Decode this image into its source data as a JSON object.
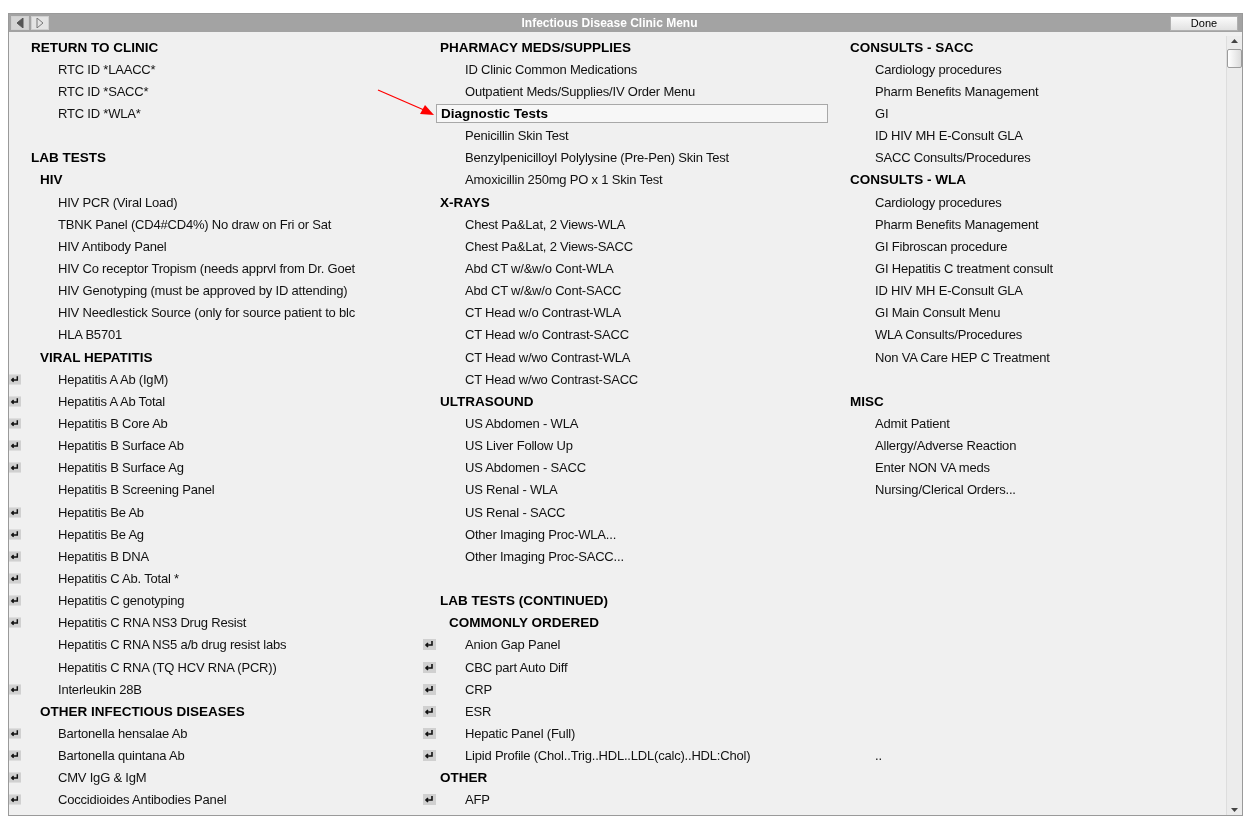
{
  "window": {
    "title": "Infectious Disease Clinic Menu"
  },
  "nav": [
    {
      "kind": "back",
      "disabled": false
    },
    {
      "kind": "forward",
      "disabled": true
    }
  ],
  "done_button": "Done",
  "columns": [
    {
      "rows": [
        {
          "kind": "header",
          "label": "RETURN TO CLINIC",
          "selected": false
        },
        {
          "kind": "item",
          "label": "RTC ID *LAACC*",
          "quick": false,
          "selected": false
        },
        {
          "kind": "item",
          "label": "RTC ID *SACC*",
          "quick": false,
          "selected": false
        },
        {
          "kind": "item",
          "label": "RTC ID *WLA*",
          "quick": false,
          "selected": false
        },
        {
          "kind": "blank"
        },
        {
          "kind": "header",
          "label": "LAB TESTS",
          "selected": false
        },
        {
          "kind": "subheader",
          "label": "HIV",
          "selected": false
        },
        {
          "kind": "item",
          "label": "HIV PCR (Viral Load)",
          "quick": false,
          "selected": false
        },
        {
          "kind": "item",
          "label": "TBNK Panel (CD4#CD4%) No draw on Fri or Sat",
          "quick": false,
          "selected": false
        },
        {
          "kind": "item",
          "label": "HIV Antibody Panel",
          "quick": false,
          "selected": false
        },
        {
          "kind": "item",
          "label": "HIV Co receptor Tropism (needs apprvl from Dr. Goet",
          "quick": false,
          "selected": false
        },
        {
          "kind": "item",
          "label": "HIV Genotyping (must be approved by ID attending)",
          "quick": false,
          "selected": false
        },
        {
          "kind": "item",
          "label": "HIV Needlestick Source (only for source patient to blc",
          "quick": false,
          "selected": false
        },
        {
          "kind": "item",
          "label": "HLA B5701",
          "quick": false,
          "selected": false
        },
        {
          "kind": "subheader",
          "label": "VIRAL HEPATITIS",
          "selected": false
        },
        {
          "kind": "item",
          "label": "Hepatitis A Ab (IgM)",
          "quick": true,
          "selected": false
        },
        {
          "kind": "item",
          "label": "Hepatitis A Ab Total",
          "quick": true,
          "selected": false
        },
        {
          "kind": "item",
          "label": "Hepatitis B Core Ab",
          "quick": true,
          "selected": false
        },
        {
          "kind": "item",
          "label": "Hepatitis B Surface Ab",
          "quick": true,
          "selected": false
        },
        {
          "kind": "item",
          "label": "Hepatitis B Surface Ag",
          "quick": true,
          "selected": false
        },
        {
          "kind": "item",
          "label": "Hepatitis B Screening Panel",
          "quick": false,
          "selected": false
        },
        {
          "kind": "item",
          "label": "Hepatitis Be Ab",
          "quick": true,
          "selected": false
        },
        {
          "kind": "item",
          "label": "Hepatitis Be Ag",
          "quick": true,
          "selected": false
        },
        {
          "kind": "item",
          "label": "Hepatitis B DNA",
          "quick": true,
          "selected": false
        },
        {
          "kind": "item",
          "label": "Hepatitis C Ab. Total *",
          "quick": true,
          "selected": false
        },
        {
          "kind": "item",
          "label": "Hepatitis C genotyping",
          "quick": true,
          "selected": false
        },
        {
          "kind": "item",
          "label": "Hepatitis C RNA NS3 Drug Resist",
          "quick": true,
          "selected": false
        },
        {
          "kind": "item",
          "label": "Hepatitis C RNA NS5 a/b drug resist labs",
          "quick": false,
          "selected": false
        },
        {
          "kind": "item",
          "label": "Hepatitis C RNA (TQ HCV RNA (PCR))",
          "quick": false,
          "selected": false
        },
        {
          "kind": "item",
          "label": "Interleukin 28B",
          "quick": true,
          "selected": false
        },
        {
          "kind": "subheader",
          "label": "OTHER INFECTIOUS DISEASES",
          "selected": false
        },
        {
          "kind": "item",
          "label": "Bartonella hensalae Ab",
          "quick": true,
          "selected": false
        },
        {
          "kind": "item",
          "label": "Bartonella quintana Ab",
          "quick": true,
          "selected": false
        },
        {
          "kind": "item",
          "label": "CMV IgG & IgM",
          "quick": true,
          "selected": false
        },
        {
          "kind": "item",
          "label": "Coccidioides Antibodies Panel",
          "quick": true,
          "selected": false
        }
      ]
    },
    {
      "rows": [
        {
          "kind": "header",
          "label": "PHARMACY MEDS/SUPPLIES",
          "selected": false
        },
        {
          "kind": "item",
          "label": "ID Clinic Common Medications",
          "quick": false,
          "selected": false
        },
        {
          "kind": "item",
          "label": "Outpatient Meds/Supplies/IV Order Menu",
          "quick": false,
          "selected": false
        },
        {
          "kind": "header",
          "label": "Diagnostic Tests",
          "selected": true
        },
        {
          "kind": "item",
          "label": "Penicillin Skin Test",
          "quick": false,
          "selected": false
        },
        {
          "kind": "item",
          "label": "Benzylpenicilloyl Polylysine (Pre-Pen) Skin Test",
          "quick": false,
          "selected": false
        },
        {
          "kind": "item",
          "label": "Amoxicillin 250mg PO x 1 Skin Test",
          "quick": false,
          "selected": false
        },
        {
          "kind": "header",
          "label": "X-RAYS",
          "selected": false
        },
        {
          "kind": "item",
          "label": "Chest Pa&Lat, 2 Views-WLA",
          "quick": false,
          "selected": false
        },
        {
          "kind": "item",
          "label": "Chest Pa&Lat, 2 Views-SACC",
          "quick": false,
          "selected": false
        },
        {
          "kind": "item",
          "label": "Abd CT w/&w/o Cont-WLA",
          "quick": false,
          "selected": false
        },
        {
          "kind": "item",
          "label": "Abd CT w/&w/o Cont-SACC",
          "quick": false,
          "selected": false
        },
        {
          "kind": "item",
          "label": "CT Head w/o Contrast-WLA",
          "quick": false,
          "selected": false
        },
        {
          "kind": "item",
          "label": "CT Head w/o Contrast-SACC",
          "quick": false,
          "selected": false
        },
        {
          "kind": "item",
          "label": "CT Head w/wo Contrast-WLA",
          "quick": false,
          "selected": false
        },
        {
          "kind": "item",
          "label": "CT Head w/wo Contrast-SACC",
          "quick": false,
          "selected": false
        },
        {
          "kind": "header",
          "label": "ULTRASOUND",
          "selected": false
        },
        {
          "kind": "item",
          "label": "US Abdomen - WLA",
          "quick": false,
          "selected": false
        },
        {
          "kind": "item",
          "label": "US Liver Follow Up",
          "quick": false,
          "selected": false
        },
        {
          "kind": "item",
          "label": "US Abdomen - SACC",
          "quick": false,
          "selected": false
        },
        {
          "kind": "item",
          "label": "US Renal - WLA",
          "quick": false,
          "selected": false
        },
        {
          "kind": "item",
          "label": "US Renal - SACC",
          "quick": false,
          "selected": false
        },
        {
          "kind": "item",
          "label": "Other Imaging Proc-WLA...",
          "quick": false,
          "selected": false
        },
        {
          "kind": "item",
          "label": "Other Imaging Proc-SACC...",
          "quick": false,
          "selected": false
        },
        {
          "kind": "blank"
        },
        {
          "kind": "header",
          "label": "LAB TESTS (CONTINUED)",
          "selected": false
        },
        {
          "kind": "subheader",
          "label": "COMMONLY ORDERED",
          "selected": false
        },
        {
          "kind": "item",
          "label": "Anion Gap Panel",
          "quick": true,
          "selected": false
        },
        {
          "kind": "item",
          "label": "CBC  part Auto Diff",
          "quick": true,
          "selected": false
        },
        {
          "kind": "item",
          "label": "CRP",
          "quick": true,
          "selected": false
        },
        {
          "kind": "item",
          "label": "ESR",
          "quick": true,
          "selected": false
        },
        {
          "kind": "item",
          "label": "Hepatic Panel (Full)",
          "quick": true,
          "selected": false
        },
        {
          "kind": "item",
          "label": "Lipid Profile (Chol..Trig..HDL..LDL(calc)..HDL:Chol)",
          "quick": true,
          "selected": false
        },
        {
          "kind": "header",
          "label": "OTHER",
          "selected": false
        },
        {
          "kind": "item",
          "label": "AFP",
          "quick": true,
          "selected": false
        }
      ]
    },
    {
      "rows": [
        {
          "kind": "header",
          "label": "CONSULTS - SACC",
          "selected": false
        },
        {
          "kind": "item",
          "label": "Cardiology procedures",
          "quick": false,
          "selected": false
        },
        {
          "kind": "item",
          "label": "Pharm Benefits Management",
          "quick": false,
          "selected": false
        },
        {
          "kind": "item",
          "label": "GI",
          "quick": false,
          "selected": false
        },
        {
          "kind": "item",
          "label": "ID HIV MH E-Consult GLA",
          "quick": false,
          "selected": false
        },
        {
          "kind": "item",
          "label": "SACC Consults/Procedures",
          "quick": false,
          "selected": false
        },
        {
          "kind": "header",
          "label": "CONSULTS - WLA",
          "selected": false
        },
        {
          "kind": "item",
          "label": "Cardiology procedures",
          "quick": false,
          "selected": false
        },
        {
          "kind": "item",
          "label": "Pharm Benefits Management",
          "quick": false,
          "selected": false
        },
        {
          "kind": "item",
          "label": "GI Fibroscan procedure",
          "quick": false,
          "selected": false
        },
        {
          "kind": "item",
          "label": "GI Hepatitis C treatment consult",
          "quick": false,
          "selected": false
        },
        {
          "kind": "item",
          "label": "ID HIV MH E-Consult GLA",
          "quick": false,
          "selected": false
        },
        {
          "kind": "item",
          "label": "GI Main Consult Menu",
          "quick": false,
          "selected": false
        },
        {
          "kind": "item",
          "label": "WLA Consults/Procedures",
          "quick": false,
          "selected": false
        },
        {
          "kind": "item",
          "label": "Non VA Care HEP C Treatment",
          "quick": false,
          "selected": false
        },
        {
          "kind": "blank"
        },
        {
          "kind": "header",
          "label": "MISC",
          "selected": false
        },
        {
          "kind": "item",
          "label": "Admit Patient",
          "quick": false,
          "selected": false
        },
        {
          "kind": "item",
          "label": "Allergy/Adverse Reaction",
          "quick": false,
          "selected": false
        },
        {
          "kind": "item",
          "label": "Enter NON VA meds",
          "quick": false,
          "selected": false
        },
        {
          "kind": "item",
          "label": "Nursing/Clerical Orders...",
          "quick": false,
          "selected": false
        },
        {
          "kind": "blank"
        },
        {
          "kind": "blank"
        },
        {
          "kind": "blank"
        },
        {
          "kind": "blank"
        },
        {
          "kind": "blank"
        },
        {
          "kind": "blank"
        },
        {
          "kind": "blank"
        },
        {
          "kind": "blank"
        },
        {
          "kind": "blank"
        },
        {
          "kind": "blank"
        },
        {
          "kind": "blank"
        },
        {
          "kind": "item",
          "label": "..",
          "quick": false,
          "selected": false
        }
      ]
    }
  ]
}
